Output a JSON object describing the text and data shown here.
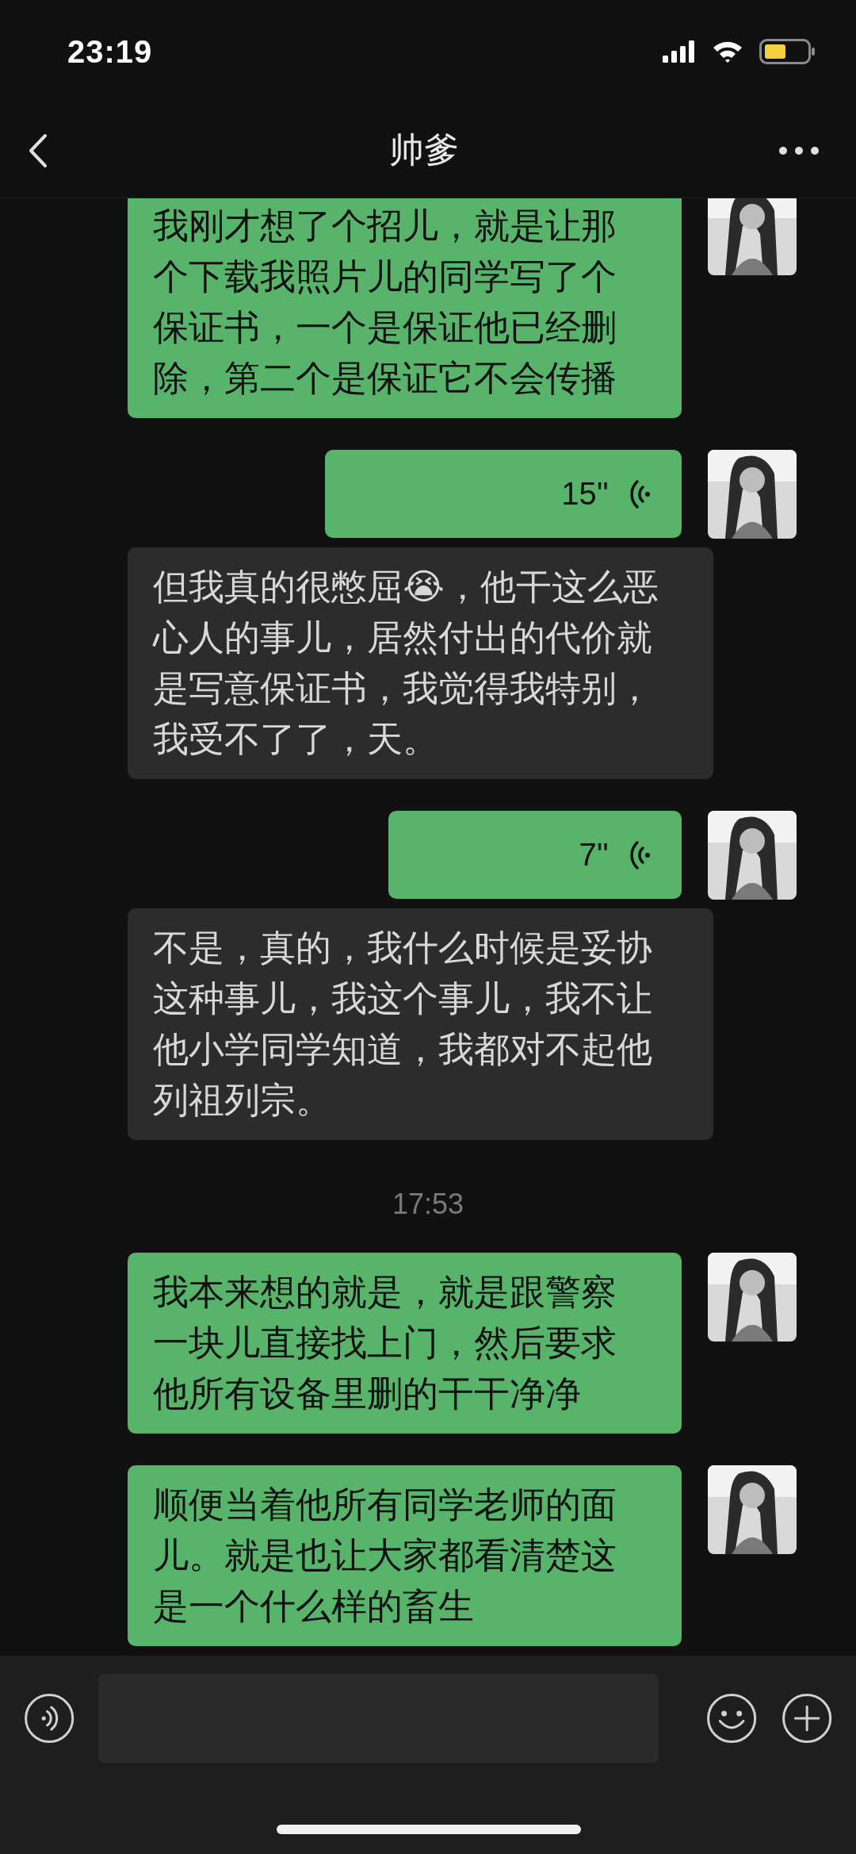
{
  "status_bar": {
    "time": "23:19"
  },
  "nav": {
    "title": "帅爹"
  },
  "messages": [
    {
      "kind": "text",
      "outgoing": true,
      "text": "我刚才想了个招儿，就是让那个下载我照片儿的同学写了个保证书，一个是保证他已经删除，第二个是保证它不会传播"
    },
    {
      "kind": "voice",
      "outgoing": true,
      "duration": "15''"
    },
    {
      "kind": "text",
      "outgoing": false,
      "text": "但我真的很憋屈😭，他干这么恶心人的事儿，居然付出的代价就是写意保证书，我觉得我特别，我受不了了，天。"
    },
    {
      "kind": "voice",
      "outgoing": true,
      "duration": "7''"
    },
    {
      "kind": "text",
      "outgoing": false,
      "text": "不是，真的，我什么时候是妥协这种事儿，我这个事儿，我不让他小学同学知道，我都对不起他列祖列宗。"
    },
    {
      "kind": "time",
      "text": "17:53"
    },
    {
      "kind": "text",
      "outgoing": true,
      "text": "我本来想的就是，就是跟警察一块儿直接找上门，然后要求他所有设备里删的干干净净"
    },
    {
      "kind": "text",
      "outgoing": true,
      "text": "顺便当着他所有同学老师的面儿。就是也让大家都看清楚这是一个什么样的畜生"
    }
  ]
}
